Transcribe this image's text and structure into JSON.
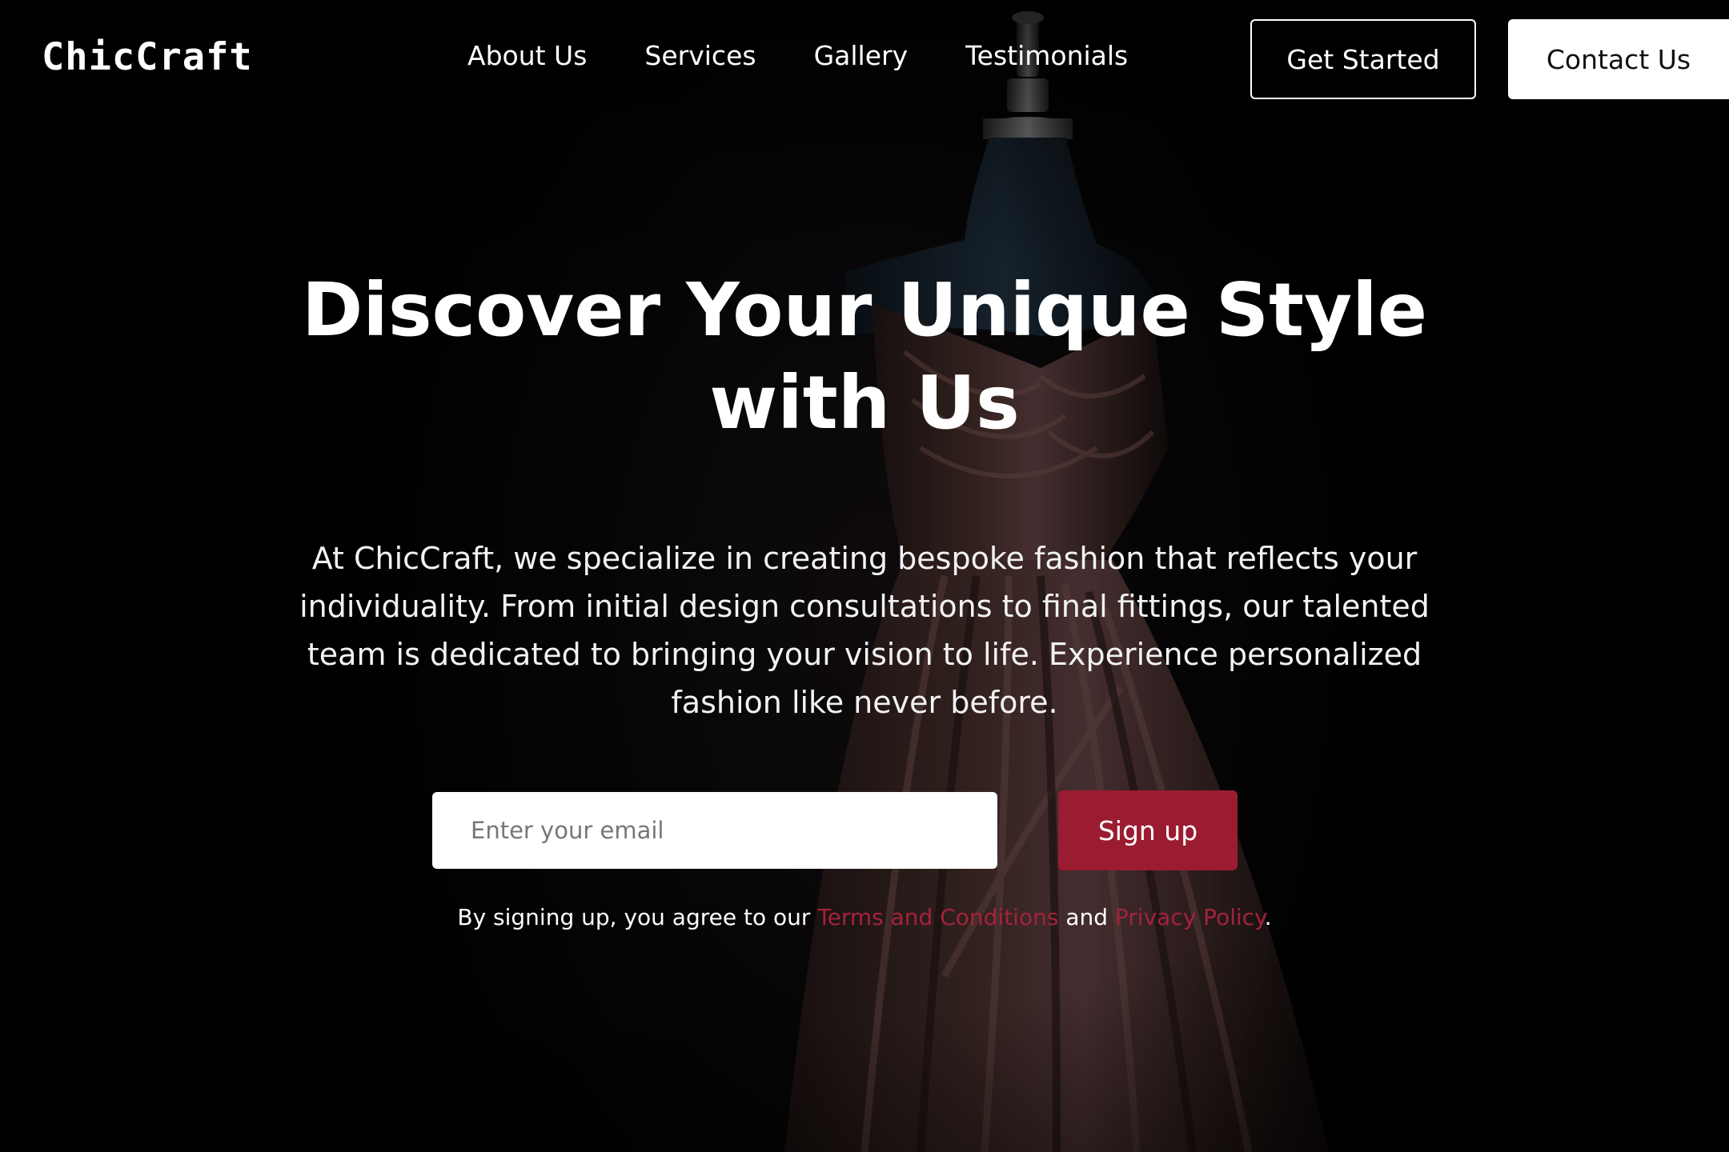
{
  "brand": {
    "name": "ChicCraft"
  },
  "nav": {
    "items": [
      {
        "label": "About Us"
      },
      {
        "label": "Services"
      },
      {
        "label": "Gallery"
      },
      {
        "label": "Testimonials"
      }
    ],
    "get_started_label": "Get Started",
    "contact_label": "Contact Us"
  },
  "hero": {
    "title_line1": "Discover Your Unique Style",
    "title_line2": "with Us",
    "description": "At ChicCraft, we specialize in creating bespoke fashion that reflects your individuality. From initial design consultations to final fittings, our talented team is dedicated to bringing your vision to life. Experience personalized fashion like never before."
  },
  "signup": {
    "email_placeholder": "Enter your email",
    "button_label": "Sign up",
    "consent_prefix": "By signing up, you agree to our ",
    "terms_label": "Terms and Conditions",
    "consent_middle": " and ",
    "privacy_label": "Privacy Policy",
    "consent_suffix": "."
  },
  "colors": {
    "accent": "#9b1c31",
    "link": "#a3233a",
    "background": "#000000",
    "dress": "#3a2624"
  }
}
